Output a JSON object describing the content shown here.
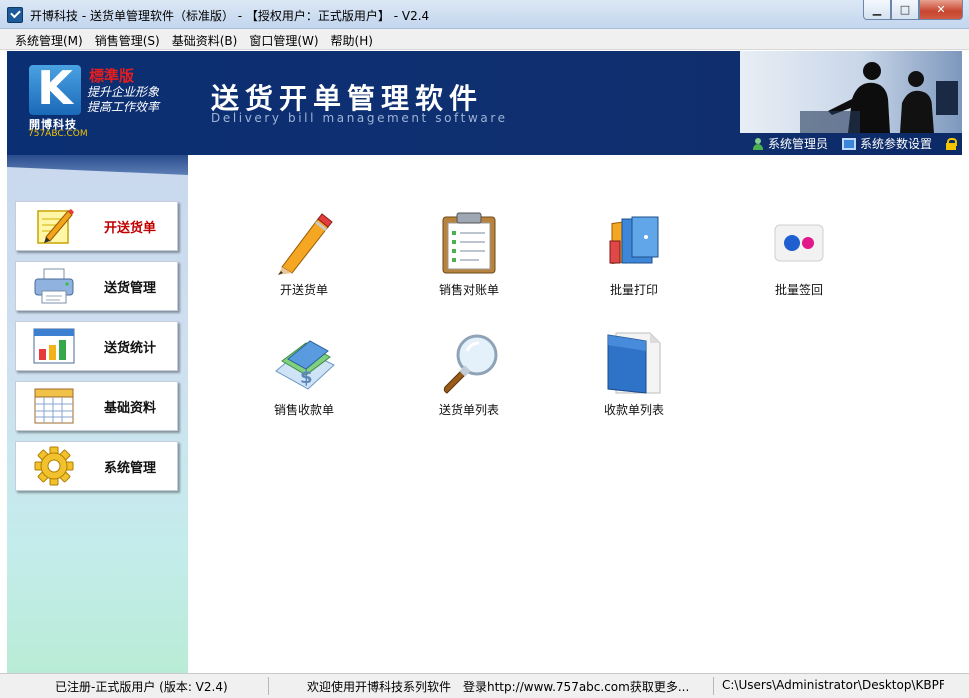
{
  "window": {
    "title": "开博科技 - 送货单管理软件（标准版） - 【授权用户：正式版用户】 - V2.4",
    "min_glyph": "▁",
    "max_glyph": "□",
    "close_glyph": "✕"
  },
  "menu": [
    {
      "label": "系统管理(M)"
    },
    {
      "label": "销售管理(S)"
    },
    {
      "label": "基础资料(B)"
    },
    {
      "label": "窗口管理(W)"
    },
    {
      "label": "帮助(H)"
    }
  ],
  "banner": {
    "logo_letter": "K",
    "company": "開博科技",
    "url": "757ABC.COM",
    "edition": "標準版",
    "slogan_1": "提升企业形象",
    "slogan_2": "提高工作效率",
    "title": "送货开单管理软件",
    "subtitle": "Delivery bill management software",
    "user_label": "系统管理员",
    "settings_label": "系统参数设置"
  },
  "sidebar": {
    "items": [
      {
        "label": "开送货单",
        "icon": "pencil-note-icon",
        "active": true
      },
      {
        "label": "送货管理",
        "icon": "printer-icon",
        "active": false
      },
      {
        "label": "送货统计",
        "icon": "bar-chart-icon",
        "active": false
      },
      {
        "label": "基础资料",
        "icon": "calendar-grid-icon",
        "active": false
      },
      {
        "label": "系统管理",
        "icon": "gear-icon",
        "active": false
      }
    ]
  },
  "main": {
    "tiles": [
      {
        "label": "开送货单",
        "icon": "pencil-icon"
      },
      {
        "label": "销售对账单",
        "icon": "clipboard-icon"
      },
      {
        "label": "批量打印",
        "icon": "batch-print-icon"
      },
      {
        "label": "批量签回",
        "icon": "dots-icon"
      },
      {
        "label": "销售收款单",
        "icon": "money-card-icon"
      },
      {
        "label": "送货单列表",
        "icon": "magnifier-icon"
      },
      {
        "label": "收款单列表",
        "icon": "folder-icon"
      }
    ]
  },
  "statusbar": {
    "registration": "已注册-正式版用户 (版本: V2.4)",
    "welcome": "欢迎使用开博科技系列软件　登录http://www.757abc.com获取更多...",
    "path": "C:\\Users\\Administrator\\Desktop\\KBPF"
  }
}
